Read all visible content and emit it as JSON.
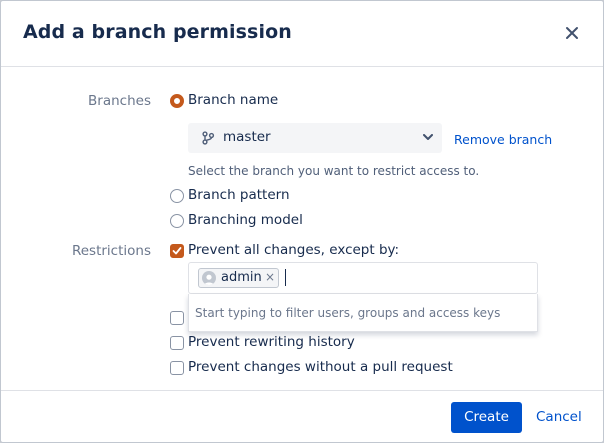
{
  "dialog": {
    "title": "Add a branch permission",
    "close_icon": "close-icon"
  },
  "branches": {
    "label": "Branches",
    "options": [
      {
        "label": "Branch name",
        "selected": true
      },
      {
        "label": "Branch pattern",
        "selected": false
      },
      {
        "label": "Branching model",
        "selected": false
      }
    ],
    "select": {
      "value": "master",
      "icon": "branch-icon"
    },
    "remove_link": "Remove branch",
    "help_text": "Select the branch you want to restrict access to."
  },
  "restrictions": {
    "label": "Restrictions",
    "prevent_all": {
      "label": "Prevent all changes, except by:",
      "checked": true
    },
    "exceptions": {
      "tags": [
        {
          "name": "admin",
          "remove": "×"
        }
      ],
      "dropdown_hint": "Start typing to filter users, groups and access keys"
    },
    "options": [
      {
        "label": "Prevent rewriting history",
        "checked": false
      },
      {
        "label": "Prevent changes without a pull request",
        "checked": false
      }
    ]
  },
  "footer": {
    "create_label": "Create",
    "cancel_label": "Cancel"
  },
  "colors": {
    "accent": "#c4591c",
    "primary": "#0052cc"
  }
}
